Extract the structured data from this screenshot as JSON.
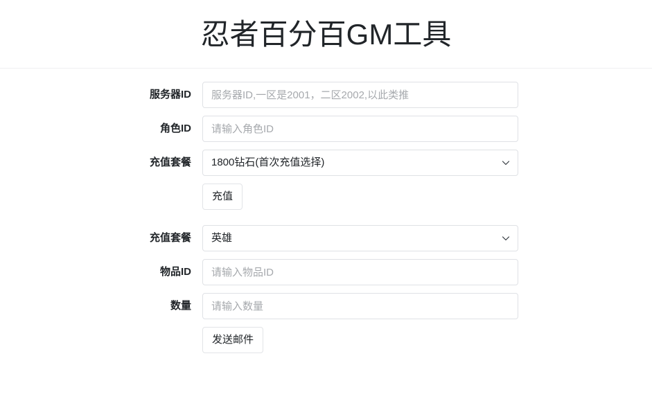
{
  "header": {
    "title": "忍者百分百GM工具"
  },
  "form": {
    "server_id": {
      "label": "服务器ID",
      "placeholder": "服务器ID,一区是2001，二区2002,以此类推",
      "value": ""
    },
    "role_id": {
      "label": "角色ID",
      "placeholder": "请输入角色ID",
      "value": ""
    },
    "recharge_package": {
      "label": "充值套餐",
      "selected": "1800钻石(首次充值选择)"
    },
    "recharge_button": {
      "label": "充值"
    },
    "item_package": {
      "label": "充值套餐",
      "selected": "英雄"
    },
    "item_id": {
      "label": "物品ID",
      "placeholder": "请输入物品ID",
      "value": ""
    },
    "quantity": {
      "label": "数量",
      "placeholder": "请输入数量",
      "value": ""
    },
    "send_mail_button": {
      "label": "发送邮件"
    }
  },
  "icons": {
    "chevron_down": "chevron-down-icon"
  },
  "colors": {
    "text": "#212529",
    "placeholder": "#a6a9ad",
    "border": "#dfe1e5",
    "divider": "#f0f0f2",
    "background": "#ffffff"
  }
}
